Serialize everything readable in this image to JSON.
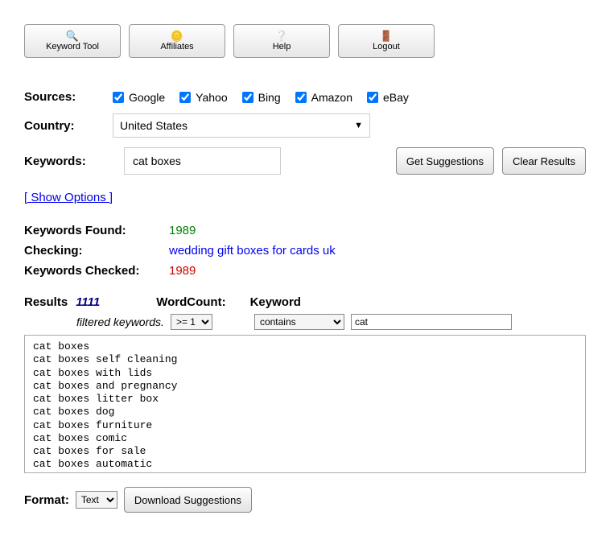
{
  "toolbar": {
    "keyword_tool": "Keyword Tool",
    "affiliates": "Affiliates",
    "help": "Help",
    "logout": "Logout"
  },
  "labels": {
    "sources": "Sources:",
    "country": "Country:",
    "keywords": "Keywords:",
    "show_options": "[ Show Options ]",
    "keywords_found": "Keywords Found:",
    "checking": "Checking:",
    "keywords_checked": "Keywords Checked:",
    "results": "Results",
    "filtered": "filtered keywords.",
    "wordcount": "WordCount:",
    "keyword_col": "Keyword",
    "format": "Format:"
  },
  "sources": {
    "google": "Google",
    "yahoo": "Yahoo",
    "bing": "Bing",
    "amazon": "Amazon",
    "ebay": "eBay"
  },
  "country": {
    "value": "United States"
  },
  "keywords_input": {
    "value": "cat boxes"
  },
  "buttons": {
    "get_suggestions": "Get Suggestions",
    "clear_results": "Clear Results",
    "download": "Download Suggestions"
  },
  "status": {
    "found": "1989",
    "checking": "wedding gift boxes for cards uk",
    "checked": "1989"
  },
  "filters": {
    "result_count": "1111",
    "wordcount_sel": ">= 1",
    "keyword_op": "contains",
    "keyword_val": "cat"
  },
  "format": {
    "value": "Text"
  },
  "results_text": "cat boxes\ncat boxes self cleaning\ncat boxes with lids\ncat boxes and pregnancy\ncat boxes litter box\ncat boxes dog\ncat boxes furniture\ncat boxes comic\ncat boxes for sale\ncat boxes automatic\ncat boxes washing machine"
}
